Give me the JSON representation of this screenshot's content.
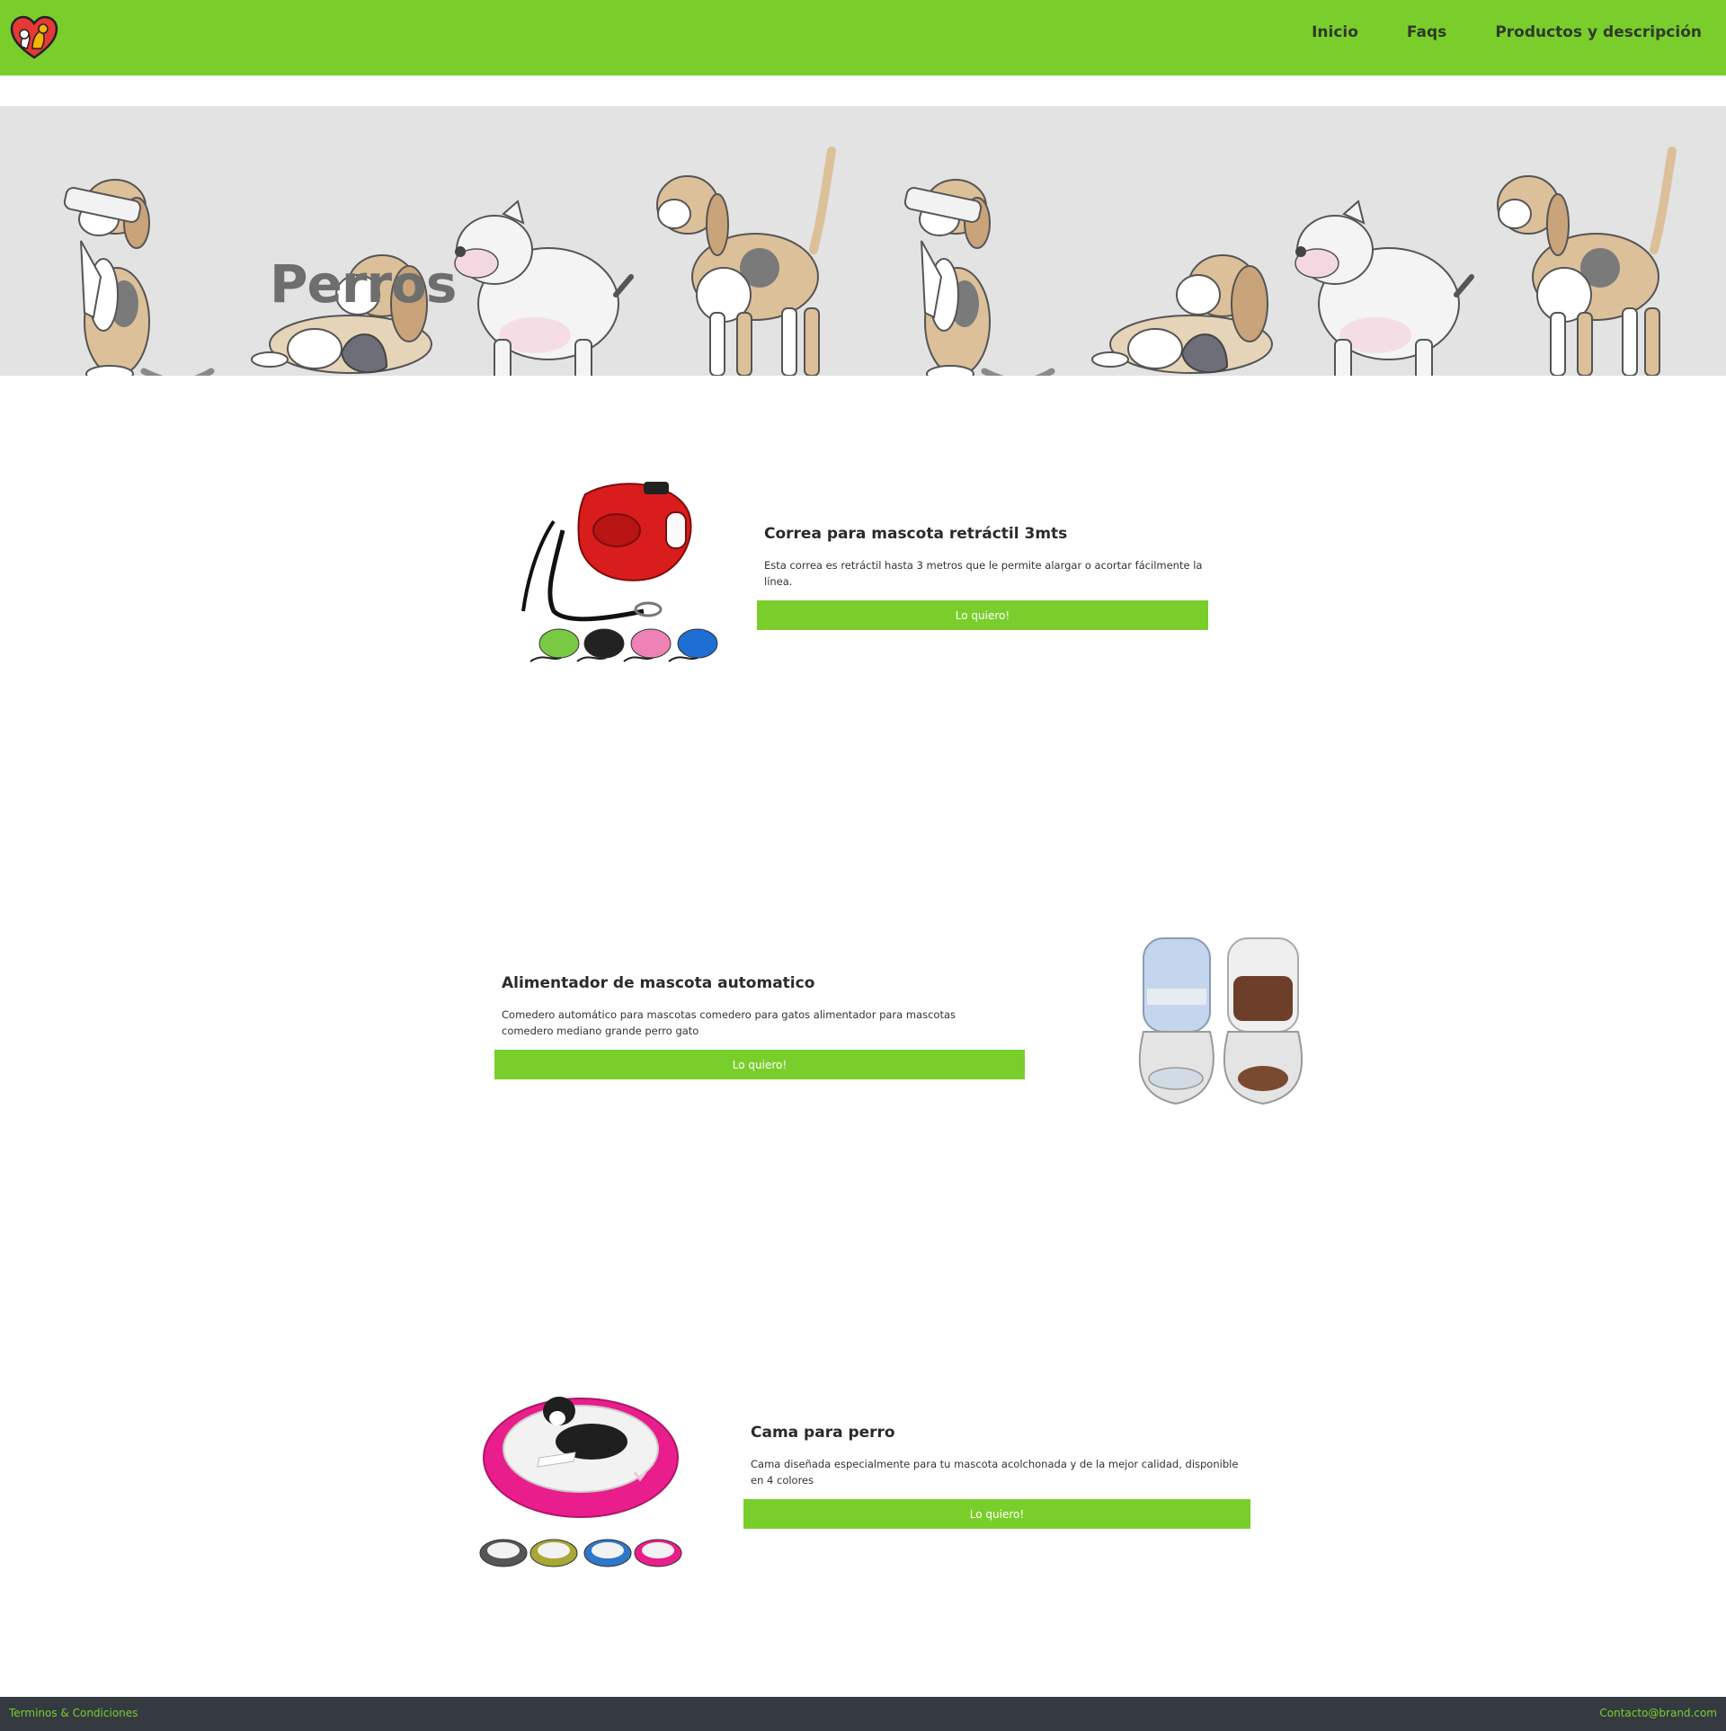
{
  "header": {
    "nav": [
      {
        "label": "Inicio"
      },
      {
        "label": "Faqs"
      },
      {
        "label": "Productos y descripción"
      }
    ],
    "logo_icon": "heart-pets-logo-icon",
    "color": "#7ace2c"
  },
  "hero": {
    "title": "Perros",
    "background": "#e3e3e3",
    "illustration": "dogs-pattern"
  },
  "products": [
    {
      "title": "Correa para mascota retráctil 3mts",
      "description": "Esta correa es retráctil hasta 3 metros que le permite alargar o acortar fácilmente la línea.",
      "button": "Lo quiero!",
      "image": "retractable-leash-image"
    },
    {
      "title": "Alimentador de mascota automatico",
      "description": "Comedero automático para mascotas comedero para gatos alimentador para mascotas comedero mediano grande perro gato",
      "button": "Lo quiero!",
      "image": "automatic-feeder-image"
    },
    {
      "title": "Cama para perro",
      "description": "Cama diseñada especialmente para tu mascota acolchonada y de la mejor calidad, disponible en 4 colores",
      "button": "Lo quiero!",
      "image": "dog-bed-image"
    }
  ],
  "footer": {
    "terms": "Terminos & Condiciones",
    "contact": "Contacto@brand.com",
    "background": "#343a40",
    "link_color": "#7ace2c"
  }
}
